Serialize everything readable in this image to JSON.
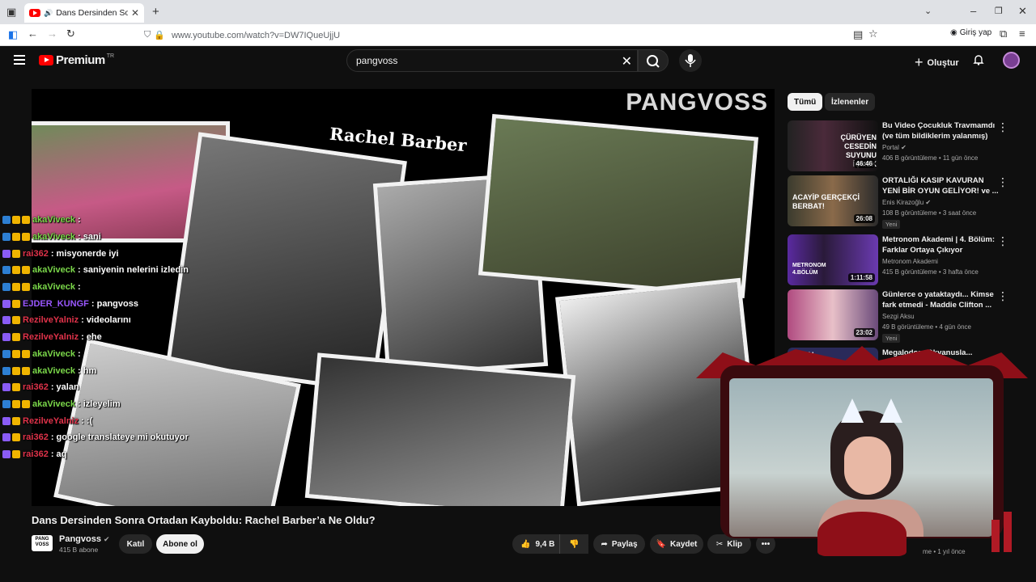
{
  "browser": {
    "tab_title": "Dans Dersinden Sonra Orta",
    "url": "www.youtube.com/watch?v=DW7IQueUjjU",
    "signin_label": "Giriş yap"
  },
  "header": {
    "logo_text": "Premium",
    "logo_region": "TR",
    "search_value": "pangvoss",
    "create_label": "Oluştur"
  },
  "player": {
    "brand_text": "PANGVOSS",
    "overlay_title": "Rachel Barber"
  },
  "chat": [
    {
      "user": "akaViveck",
      "msg": ": ",
      "color": "#7bd84a"
    },
    {
      "user": "akaViveck",
      "msg": ": sani",
      "color": "#7bd84a"
    },
    {
      "user": "rai362",
      "msg": ": misyonerde iyi",
      "color": "#e0334a"
    },
    {
      "user": "akaViveck",
      "msg": ": saniyenin nelerini izledin",
      "color": "#7bd84a"
    },
    {
      "user": "akaViveck",
      "msg": ": ",
      "color": "#7bd84a"
    },
    {
      "user": "EJDER_KUNGF",
      "msg": ": pangvoss",
      "color": "#9a57ff"
    },
    {
      "user": "RezilveYalniz",
      "msg": ": videolarını",
      "color": "#e0334a"
    },
    {
      "user": "RezilveYalniz",
      "msg": ": ehe",
      "color": "#e0334a"
    },
    {
      "user": "akaViveck",
      "msg": ": ",
      "color": "#7bd84a"
    },
    {
      "user": "akaViveck",
      "msg": ": hm",
      "color": "#7bd84a"
    },
    {
      "user": "rai362",
      "msg": ": yalan",
      "color": "#e0334a"
    },
    {
      "user": "akaViveck",
      "msg": ": izleyelim",
      "color": "#7bd84a"
    },
    {
      "user": "RezilveYalniz",
      "msg": ": :(",
      "color": "#e0334a"
    },
    {
      "user": "rai362",
      "msg": ": google translateye mi okutuyor",
      "color": "#e0334a"
    },
    {
      "user": "rai362",
      "msg": ": aq",
      "color": "#e0334a"
    }
  ],
  "video": {
    "title": "Dans Dersinden Sonra Ortadan Kayboldu: Rachel Barber’a Ne Oldu?",
    "channel": "Pangvoss",
    "channel_avatar_text": "PANG VOSS",
    "subscribers": "415 B abone",
    "join_label": "Katıl",
    "subscribe_label": "Abone ol",
    "likes": "9,4 B",
    "share_label": "Paylaş",
    "save_label": "Kaydet",
    "clip_label": "Klip"
  },
  "sidebar": {
    "chips": [
      "Tümü",
      "İzlenenler"
    ],
    "recs": [
      {
        "title": "Bu Video Çocukluk Travmamdı (ve tüm bildiklerim yalanmış)",
        "channel": "Portal",
        "meta": "406 B görüntüleme • 11 gün önce",
        "duration": "46:46",
        "thumb_text": "ÇÜRÜYEN CESEDİN SUYUNU İÇMEK",
        "new": ""
      },
      {
        "title": "ORTALIĞI KASIP KAVURAN YENİ BİR OYUN GELİYOR! ve ...",
        "channel": "Enis Kirazoğlu",
        "meta": "108 B görüntüleme • 3 saat önce",
        "duration": "26:08",
        "thumb_text": "ACAYİP GERÇEKÇİ  BERBAT!",
        "new": "Yeni"
      },
      {
        "title": "Metronom Akademi | 4. Bölüm: Farklar Ortaya Çıkıyor",
        "channel": "Metronom Akademi",
        "meta": "415 B görüntüleme • 3 hafta önce",
        "duration": "1:11:58",
        "thumb_text": "METRONOM 4.BÖLÜM",
        "new": ""
      },
      {
        "title": "Günlerce o yataktaydı... Kimse fark etmedi - Maddie Clifton ...",
        "channel": "Sezgi Aksu",
        "meta": "49 B görüntüleme • 4 gün önce",
        "duration": "23:02",
        "thumb_text": "",
        "new": "Yeni"
      },
      {
        "title": "Megalodon, Okyanusla...",
        "channel": "",
        "meta": "",
        "duration": "",
        "thumb_text": "MEGAL",
        "new": ""
      }
    ],
    "partial_meta": "me • 1 yıl önce"
  },
  "colors": {
    "bg": "#0f0f0f",
    "accent_red": "#ff0000",
    "chat_green": "#7bd84a",
    "chat_red": "#e0334a",
    "webcam_frame": "#8e0f18"
  }
}
